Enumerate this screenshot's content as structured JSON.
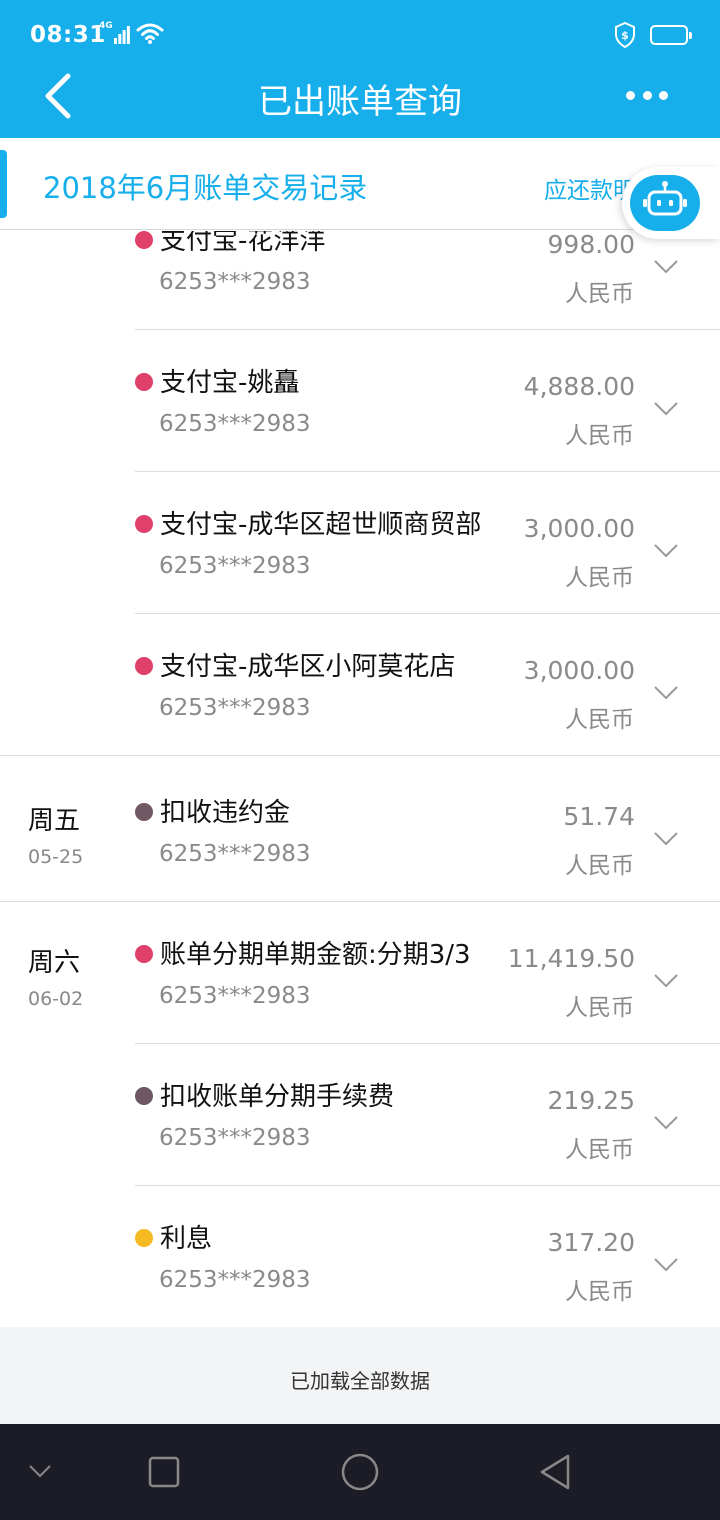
{
  "status_bar": {
    "time": "08:31",
    "network": "4G"
  },
  "header": {
    "title": "已出账单查询"
  },
  "subheader": {
    "title": "2018年6月账单交易记录",
    "link": "应还款明细"
  },
  "colors": {
    "brand": "#16aeeb",
    "dot_red": "#e0416a",
    "dot_dark": "#6f5763",
    "dot_yellow": "#f5b921"
  },
  "transactions": [
    {
      "day": "",
      "date": "",
      "merchant": "支付宝-花洋洋",
      "card": "6253***2983",
      "amount": "998.00",
      "currency": "人民币",
      "dot": "red"
    },
    {
      "day": "",
      "date": "",
      "merchant": "支付宝-姚矗",
      "card": "6253***2983",
      "amount": "4,888.00",
      "currency": "人民币",
      "dot": "red"
    },
    {
      "day": "",
      "date": "",
      "merchant": "支付宝-成华区超世顺商贸部",
      "card": "6253***2983",
      "amount": "3,000.00",
      "currency": "人民币",
      "dot": "red"
    },
    {
      "day": "",
      "date": "",
      "merchant": "支付宝-成华区小阿莫花店",
      "card": "6253***2983",
      "amount": "3,000.00",
      "currency": "人民币",
      "dot": "red"
    },
    {
      "day": "周五",
      "date": "05-25",
      "merchant": "扣收违约金",
      "card": "6253***2983",
      "amount": "51.74",
      "currency": "人民币",
      "dot": "dark"
    },
    {
      "day": "周六",
      "date": "06-02",
      "merchant": "账单分期单期金额:分期3/3",
      "card": "6253***2983",
      "amount": "11,419.50",
      "currency": "人民币",
      "dot": "red"
    },
    {
      "day": "",
      "date": "",
      "merchant": "扣收账单分期手续费",
      "card": "6253***2983",
      "amount": "219.25",
      "currency": "人民币",
      "dot": "dark"
    },
    {
      "day": "",
      "date": "",
      "merchant": "利息",
      "card": "6253***2983",
      "amount": "317.20",
      "currency": "人民币",
      "dot": "yellow"
    }
  ],
  "footer": {
    "loaded_text": "已加载全部数据"
  }
}
